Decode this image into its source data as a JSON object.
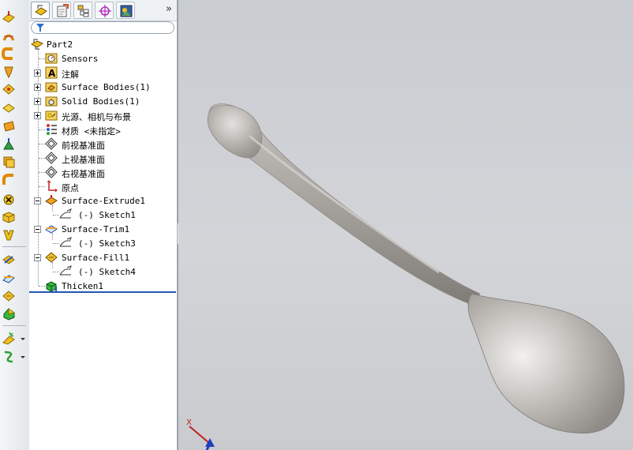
{
  "toolbar": {
    "icons": [
      "extruded-boss-icon",
      "revolved-icon",
      "swept-icon",
      "lofted-icon",
      "boundary-icon",
      "planar-surface-icon",
      "offset-icon",
      "ruled-icon",
      "fillet-icon",
      "delete-face-icon",
      "knit-icon",
      "thicken-icon",
      "trim-icon",
      "untrim-icon",
      "extend-icon",
      "fill-icon",
      "surface-plus-icon",
      "curves-icon"
    ]
  },
  "tabs": [
    "feature-manager-tab",
    "property-manager-tab",
    "configuration-manager-tab",
    "dimxpert-tab",
    "display-manager-tab"
  ],
  "tabs_more": "»",
  "tree": {
    "root": "Part2",
    "items": [
      {
        "label": "Sensors",
        "icon": "sensors-icon",
        "expander": ""
      },
      {
        "label": "注解",
        "icon": "annotations-icon",
        "expander": "plus"
      },
      {
        "label": "Surface Bodies(1)",
        "icon": "surface-bodies-folder-icon",
        "expander": "plus"
      },
      {
        "label": "Solid Bodies(1)",
        "icon": "solid-bodies-folder-icon",
        "expander": "plus"
      },
      {
        "label": "光源、相机与布景",
        "icon": "lights-cameras-icon",
        "expander": "plus"
      },
      {
        "label": "材质 <未指定>",
        "icon": "material-icon",
        "expander": ""
      },
      {
        "label": "前视基准面",
        "icon": "plane-icon",
        "expander": ""
      },
      {
        "label": "上视基准面",
        "icon": "plane-icon",
        "expander": ""
      },
      {
        "label": "右视基准面",
        "icon": "plane-icon",
        "expander": ""
      },
      {
        "label": "原点",
        "icon": "origin-icon",
        "expander": ""
      },
      {
        "label": "Surface-Extrude1",
        "icon": "surface-extrude-icon",
        "expander": "minus"
      },
      {
        "label": "(-) Sketch1",
        "icon": "sketch-icon",
        "child": true
      },
      {
        "label": "Surface-Trim1",
        "icon": "surface-trim-icon",
        "expander": "minus"
      },
      {
        "label": "(-) Sketch3",
        "icon": "sketch-icon",
        "child": true
      },
      {
        "label": "Surface-Fill1",
        "icon": "surface-fill-icon",
        "expander": "minus"
      },
      {
        "label": "(-) Sketch4",
        "icon": "sketch-icon",
        "child": true
      },
      {
        "label": "Thicken1",
        "icon": "thicken-feature-icon",
        "expander": ""
      }
    ]
  },
  "triad": {
    "x_label": "X"
  },
  "colors": {
    "accent": "#2457b0",
    "model": "#b9b6b2",
    "rollback": "#2457b0"
  }
}
